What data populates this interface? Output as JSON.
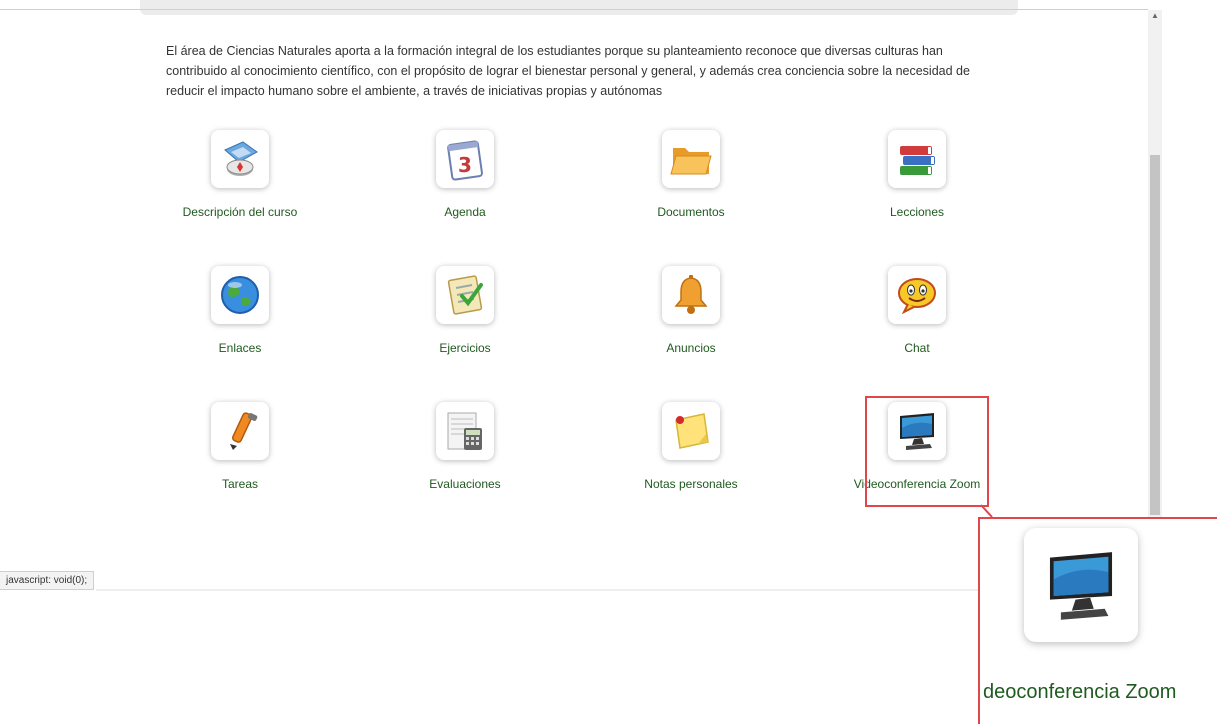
{
  "intro_text": "El área de Ciencias Naturales aporta a la formación integral de los estudiantes porque su planteamiento reconoce que diversas culturas han contribuido al conocimiento científico, con el propósito de lograr el bienestar personal y general, y además crea conciencia sobre la necesidad de reducir el impacto humano sobre el ambiente, a través de iniciativas propias y autónomas",
  "tools": [
    {
      "label": "Descripción del curso",
      "icon": "compass-map-icon"
    },
    {
      "label": "Agenda",
      "icon": "calendar-icon"
    },
    {
      "label": "Documentos",
      "icon": "folder-icon"
    },
    {
      "label": "Lecciones",
      "icon": "books-icon"
    },
    {
      "label": "Enlaces",
      "icon": "globe-icon"
    },
    {
      "label": "Ejercicios",
      "icon": "checklist-icon"
    },
    {
      "label": "Anuncios",
      "icon": "bell-icon"
    },
    {
      "label": "Chat",
      "icon": "smiley-chat-icon"
    },
    {
      "label": "Tareas",
      "icon": "pencil-icon"
    },
    {
      "label": "Evaluaciones",
      "icon": "calculator-sheet-icon"
    },
    {
      "label": "Notas personales",
      "icon": "sticky-note-icon"
    },
    {
      "label": "Videoconferencia Zoom",
      "icon": "monitor-icon"
    }
  ],
  "status_bar": "javascript: void(0);",
  "zoom_callout": {
    "label": "deoconferencia Zoom",
    "icon": "monitor-icon"
  },
  "colors": {
    "link_green": "#1f5a1f",
    "highlight_red": "#e0474c"
  }
}
